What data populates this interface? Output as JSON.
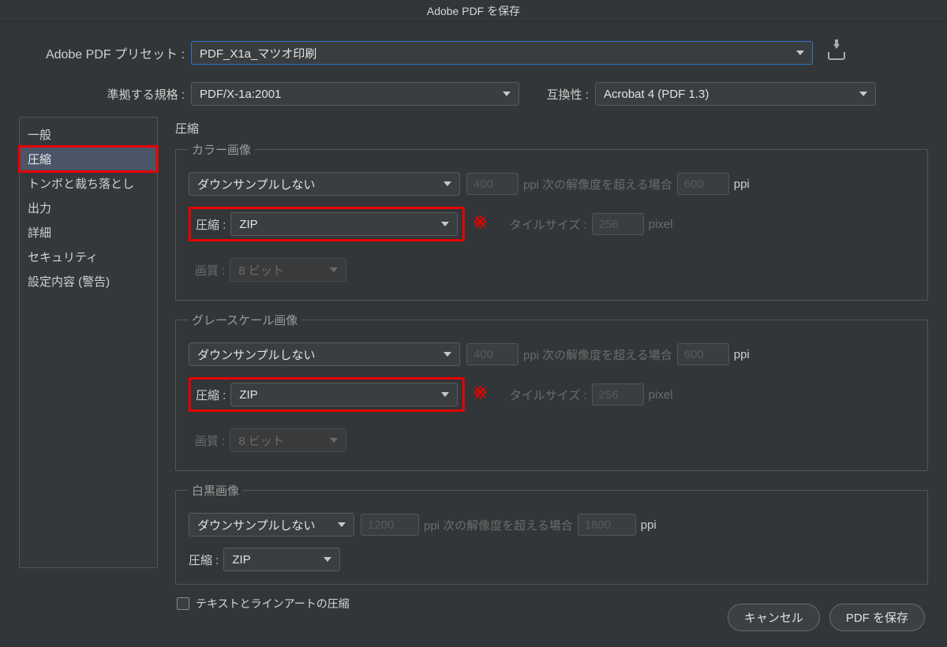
{
  "title": "Adobe PDF を保存",
  "preset": {
    "label": "Adobe PDF プリセット :",
    "value": "PDF_X1a_マツオ印刷"
  },
  "standard": {
    "label": "準拠する規格 :",
    "value": "PDF/X-1a:2001"
  },
  "compat": {
    "label": "互換性 :",
    "value": "Acrobat 4 (PDF 1.3)"
  },
  "sidebar": {
    "items": [
      "一般",
      "圧縮",
      "トンボと裁ち落とし",
      "出力",
      "詳細",
      "セキュリティ",
      "設定内容 (警告)"
    ],
    "selected": 1
  },
  "main": {
    "heading": "圧縮",
    "ppi_over_label": "ppi 次の解像度を超える場合",
    "ppi_unit": "ppi",
    "pixel_unit": "pixel",
    "tile_label": "タイルサイズ :",
    "compression_label": "圧縮 :",
    "quality_label": "画質 :",
    "color": {
      "legend": "カラー画像",
      "downsample": "ダウンサンプルしない",
      "ppi1": "400",
      "ppi2": "600",
      "compression": "ZIP",
      "tile": "256",
      "quality": "8 ビット",
      "annot": "※"
    },
    "gray": {
      "legend": "グレースケール画像",
      "downsample": "ダウンサンプルしない",
      "ppi1": "400",
      "ppi2": "600",
      "compression": "ZIP",
      "tile": "256",
      "quality": "8 ビット",
      "annot": "※"
    },
    "mono": {
      "legend": "白黒画像",
      "downsample": "ダウンサンプルしない",
      "ppi1": "1200",
      "ppi2": "1800",
      "compression": "ZIP"
    },
    "text_art_compress": "テキストとラインアートの圧縮"
  },
  "footer": {
    "cancel": "キャンセル",
    "save": "PDF を保存"
  }
}
